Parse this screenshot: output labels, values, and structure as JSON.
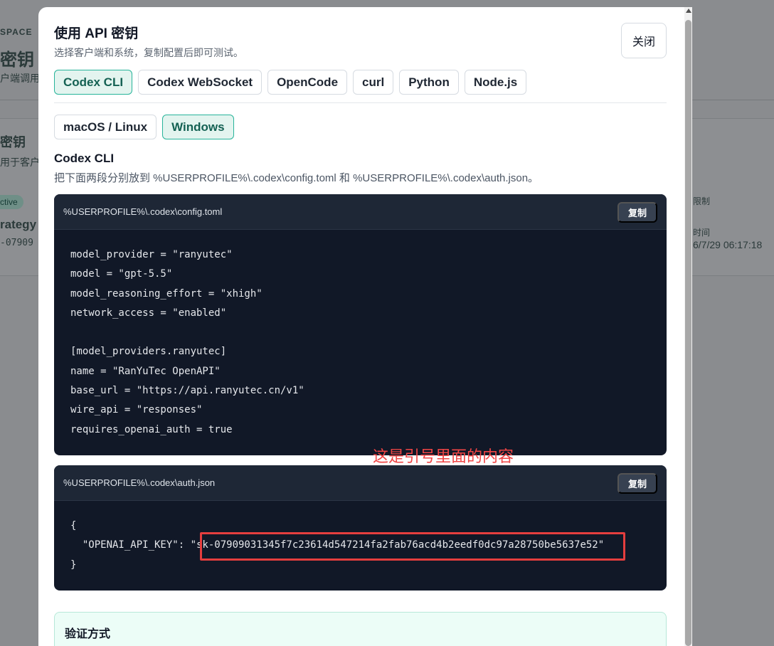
{
  "background": {
    "workspace_label": "SPACE",
    "page_title": "密钥",
    "page_subtitle": "户端调用",
    "card_title": "密钥",
    "card_subtitle": "用于客户",
    "status_badge": "ctive",
    "strategy_text": "rategy",
    "key_prefix": "-07909",
    "right_label_1": "限制",
    "right_label_2": "时间",
    "right_value_2": "6/7/29 06:17:18"
  },
  "modal": {
    "title": "使用 API 密钥",
    "subtitle": "选择客户端和系统，复制配置后即可测试。",
    "close_label": "关闭",
    "client_tabs": [
      {
        "label": "Codex CLI",
        "active": true
      },
      {
        "label": "Codex WebSocket",
        "active": false
      },
      {
        "label": "OpenCode",
        "active": false
      },
      {
        "label": "curl",
        "active": false
      },
      {
        "label": "Python",
        "active": false
      },
      {
        "label": "Node.js",
        "active": false
      }
    ],
    "os_tabs": [
      {
        "label": "macOS / Linux",
        "active": false
      },
      {
        "label": "Windows",
        "active": true
      }
    ],
    "section_title": "Codex CLI",
    "section_desc": "把下面两段分别放到 %USERPROFILE%\\.codex\\config.toml 和 %USERPROFILE%\\.codex\\auth.json。",
    "config_block": {
      "path": "%USERPROFILE%\\.codex\\config.toml",
      "copy_label": "复制",
      "lines": [
        "model_provider = \"ranyutec\"",
        "model = \"gpt-5.5\"",
        "model_reasoning_effort = \"xhigh\"",
        "network_access = \"enabled\"",
        "",
        "[model_providers.ranyutec]",
        "name = \"RanYuTec OpenAPI\"",
        "base_url = \"https://api.ranyutec.cn/v1\"",
        "wire_api = \"responses\"",
        "requires_openai_auth = true"
      ]
    },
    "auth_block": {
      "path": "%USERPROFILE%\\.codex\\auth.json",
      "copy_label": "复制",
      "lines": [
        "{",
        "  \"OPENAI_API_KEY\": \"sk-07909031345f7c23614d547214fa2fab76acd4b2eedf0dc97a28750be5637e52\"",
        "}"
      ]
    },
    "annotation_text": "这是引号里面的内容",
    "verify_title": "验证方式"
  },
  "colors": {
    "accent": "#27b49a",
    "accent_bg": "#e3f4ef",
    "code_bg": "#111827",
    "annotation": "#ef4444"
  }
}
